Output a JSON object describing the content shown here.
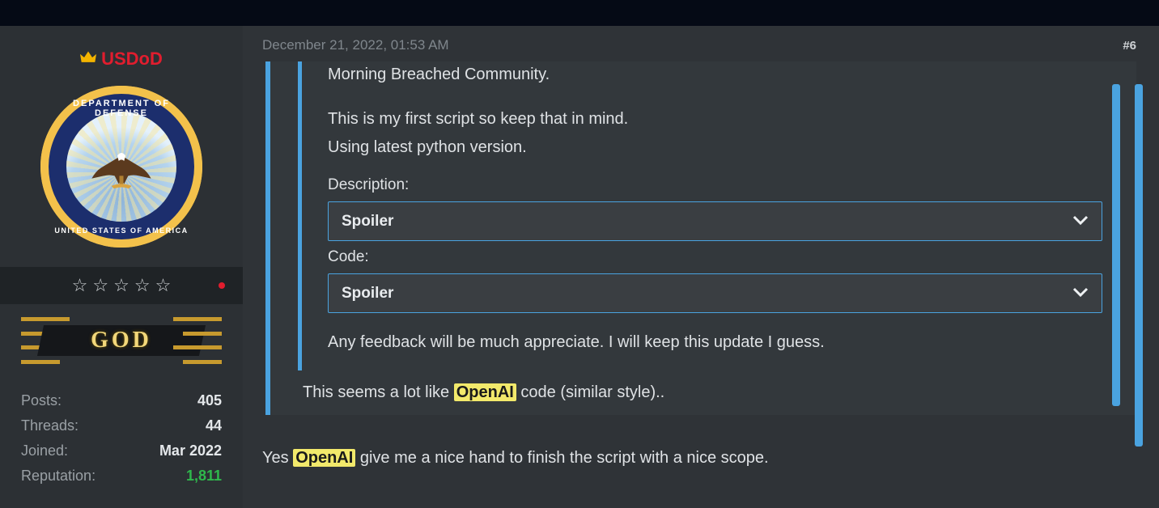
{
  "user": {
    "name": "USDoD",
    "seal_top": "DEPARTMENT OF DEFENSE",
    "seal_bottom": "UNITED STATES OF AMERICA",
    "rank": "GOD",
    "star_count": 5
  },
  "stats": {
    "posts_label": "Posts:",
    "posts_value": "405",
    "threads_label": "Threads:",
    "threads_value": "44",
    "joined_label": "Joined:",
    "joined_value": "Mar 2022",
    "reputation_label": "Reputation:",
    "reputation_value": "1,811"
  },
  "post": {
    "timestamp": "December 21, 2022, 01:53 AM",
    "number": "#6",
    "quote": {
      "line1": "Morning Breached Community.",
      "line2": "This is my first script so keep that in mind.",
      "line3": "Using latest python version.",
      "desc_label": "Description:",
      "code_label": "Code:",
      "spoiler_label": "Spoiler",
      "feedback": "Any feedback will be much appreciate. I will keep this update I guess."
    },
    "reply_prefix": "This seems a lot like ",
    "reply_hl": "OpenAI",
    "reply_suffix": " code (similar style)..",
    "answer_prefix": "Yes ",
    "answer_hl": "OpenAI",
    "answer_suffix": " give me a nice hand to finish the script with a nice scope."
  }
}
